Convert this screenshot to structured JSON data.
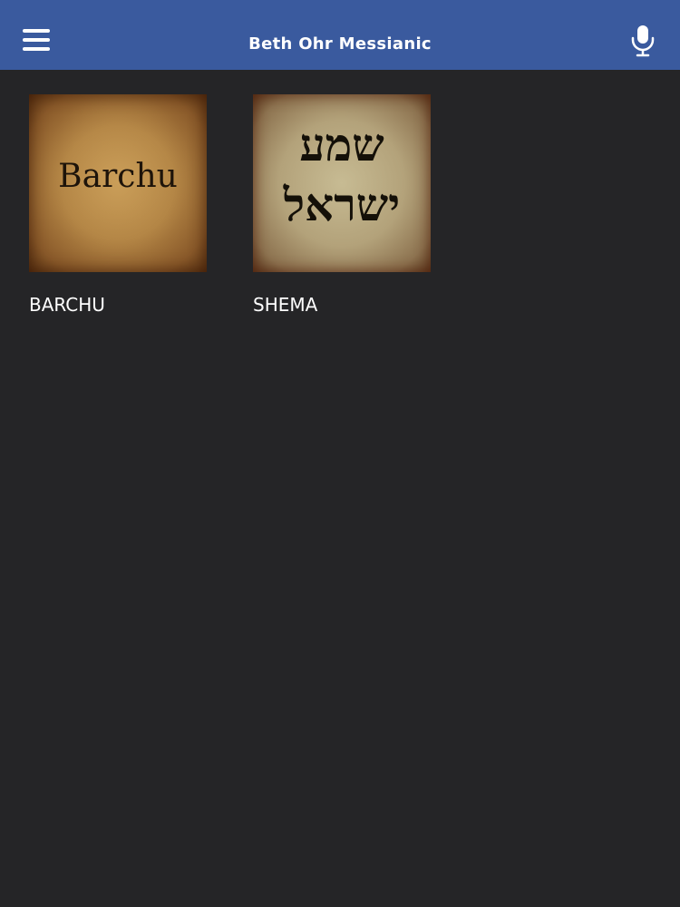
{
  "header": {
    "title": "Beth Ohr Messianic",
    "background_color": "#3a5a9e",
    "menu_icon": "hamburger-menu-icon",
    "mic_icon": "microphone-icon"
  },
  "content": {
    "background_color": "#252527",
    "items": [
      {
        "label": "BARCHU",
        "thumbnail_text": "Barchu"
      },
      {
        "label": "SHEMA",
        "thumbnail_text_line1": "שמע",
        "thumbnail_text_line2": "ישראל"
      }
    ]
  }
}
